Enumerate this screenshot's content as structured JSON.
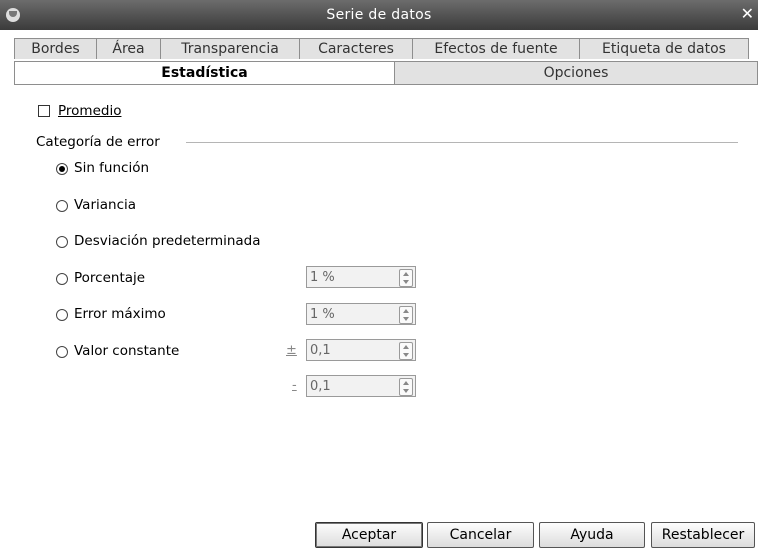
{
  "window": {
    "title": "Serie de datos"
  },
  "tabs_row1": [
    "Bordes",
    "Área",
    "Transparencia",
    "Caracteres",
    "Efectos de fuente",
    "Etiqueta de datos"
  ],
  "tabs_row2": [
    "Estadística",
    "Opciones"
  ],
  "promedio": {
    "label": "Promedio",
    "checked": false
  },
  "error_category": {
    "heading": "Categoría de error",
    "options": [
      {
        "label": "Sin función",
        "checked": true
      },
      {
        "label": "Variancia",
        "checked": false
      },
      {
        "label": "Desviación predeterminada",
        "checked": false
      },
      {
        "label": "Porcentaje",
        "checked": false
      },
      {
        "label": "Error máximo",
        "checked": false
      },
      {
        "label": "Valor constante",
        "checked": false
      }
    ]
  },
  "fields": {
    "porcentaje": "1 %",
    "error_maximo": "1 %",
    "plus_value": "0,1",
    "minus_value": "0,1",
    "plus_sign": "±",
    "minus_sign": "-"
  },
  "buttons": {
    "ok": "Aceptar",
    "cancel": "Cancelar",
    "help": "Ayuda",
    "reset": "Restablecer"
  }
}
